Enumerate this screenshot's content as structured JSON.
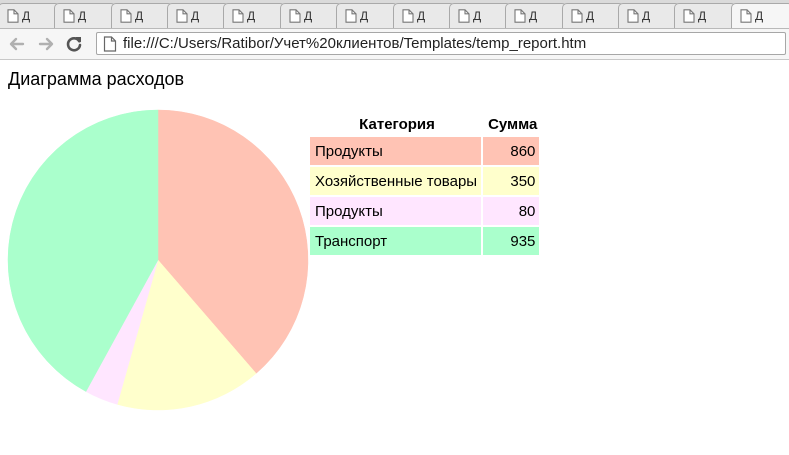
{
  "browser": {
    "tab_title": "Д",
    "tab_count": 14,
    "address": "file:///C:/Users/Ratibor/Учет%20клиентов/Templates/temp_report.htm"
  },
  "page": {
    "title": "Диаграмма расходов"
  },
  "table": {
    "headers": [
      "Категория",
      "Сумма"
    ]
  },
  "chart_data": {
    "type": "pie",
    "title": "",
    "start_angle_deg": 0,
    "direction": "clockwise",
    "slices": [
      {
        "label": "Продукты",
        "value": 860,
        "color": "#ffc3b4"
      },
      {
        "label": "Хозяйственные товары",
        "value": 350,
        "color": "#ffffcc"
      },
      {
        "label": "Продукты",
        "value": 80,
        "color": "#ffe6ff"
      },
      {
        "label": "Транспорт",
        "value": 935,
        "color": "#aaffcc"
      }
    ],
    "legend": "table-right"
  }
}
